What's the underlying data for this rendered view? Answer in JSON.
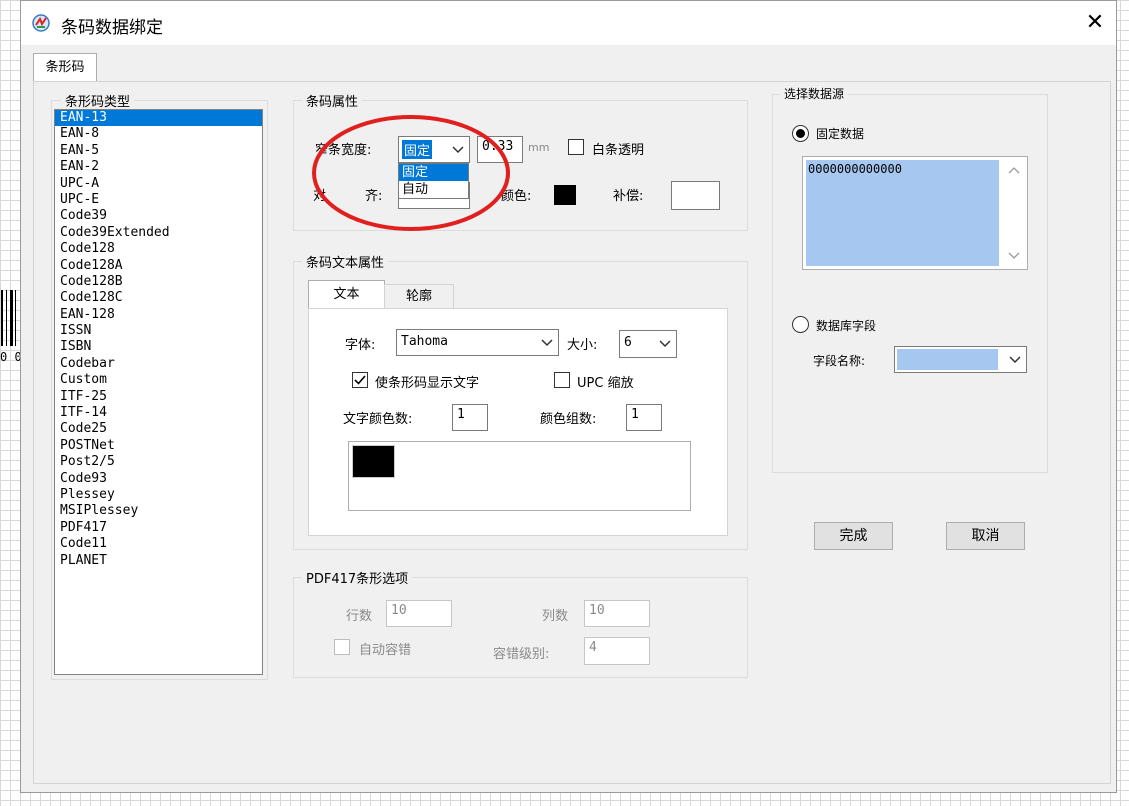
{
  "window": {
    "title": "条码数据绑定",
    "close_glyph": "✕"
  },
  "background": {
    "partial_text": "0 0"
  },
  "tabs": {
    "main_tab": "条形码"
  },
  "barcode_type": {
    "group_title": "条形码类型",
    "items": [
      "EAN-13",
      "EAN-8",
      "EAN-5",
      "EAN-2",
      "UPC-A",
      "UPC-E",
      "Code39",
      "Code39Extended",
      "Code128",
      "Code128A",
      "Code128B",
      "Code128C",
      "EAN-128",
      "ISSN",
      "ISBN",
      "Codebar",
      "Custom",
      "ITF-25",
      "ITF-14",
      "Code25",
      "POSTNet",
      "Post2/5",
      "Code93",
      "Plessey",
      "MSIPlessey",
      "PDF417",
      "Code11",
      "PLANET"
    ],
    "selected": "EAN-13"
  },
  "barcode_props": {
    "group_title": "条码属性",
    "bar_width_label": "窄条宽度:",
    "bar_width_mode": "固定",
    "bar_width_options": [
      "固定",
      "自动"
    ],
    "bar_width_value": "0.33",
    "unit": "mm",
    "white_transparent_label": "白条透明",
    "align_label_1": "对",
    "align_label_2": "齐:",
    "color_label": "颜色:",
    "bar_color": "#000000",
    "compensate_label": "补偿:",
    "compensate_value": ""
  },
  "text_props": {
    "group_title": "条码文本属性",
    "tab_text": "文本",
    "tab_outline": "轮廓",
    "font_label": "字体:",
    "font_value": "Tahoma",
    "size_label": "大小:",
    "size_value": "6",
    "show_text_label": "使条形码显示文字",
    "show_text_checked": true,
    "upc_scale_label": "UPC 缩放",
    "upc_scale_checked": false,
    "text_color_count_label": "文字颜色数:",
    "text_color_count": "1",
    "color_group_label": "颜色组数:",
    "color_group_count": "1",
    "swatch_color": "#000000"
  },
  "pdf417": {
    "group_title": "PDF417条形选项",
    "rows_label": "行数",
    "rows_value": "10",
    "cols_label": "列数",
    "cols_value": "10",
    "auto_ec_label": "自动容错",
    "ec_level_label": "容错级别:",
    "ec_level_value": "4"
  },
  "data_source": {
    "group_title": "选择数据源",
    "fixed_label": "固定数据",
    "fixed_selected": true,
    "fixed_value": "0000000000000",
    "db_label": "数据库字段",
    "db_selected": false,
    "field_name_label": "字段名称:",
    "field_value": ""
  },
  "buttons": {
    "ok": "完成",
    "cancel": "取消"
  },
  "colors": {
    "accent": "#0078d7",
    "highlight_box": "#a6c8f0",
    "annotation": "#e0201e"
  }
}
